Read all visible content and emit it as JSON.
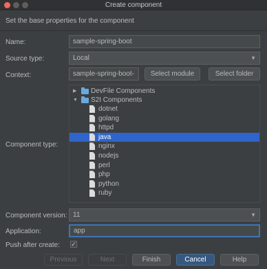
{
  "window": {
    "title": "Create component"
  },
  "header": {
    "text": "Set the base properties for the component"
  },
  "form": {
    "name_label": "Name:",
    "name_value": "sample-spring-boot",
    "source_label": "Source type:",
    "source_value": "Local",
    "context_label": "Context:",
    "context_value": "sample-spring-boot-",
    "select_module": "Select module",
    "select_folder": "Select folder",
    "component_type_label": "Component type:",
    "version_label": "Component version:",
    "version_value": "11",
    "application_label": "Application:",
    "application_value": "app",
    "push_label": "Push after create:",
    "push_checked": "✓"
  },
  "tree": {
    "devfile": "DevFile Components",
    "s2i": "S2I Components",
    "items": [
      "dotnet",
      "golang",
      "httpd",
      "java",
      "nginx",
      "nodejs",
      "perl",
      "php",
      "python",
      "ruby"
    ],
    "selected": "java"
  },
  "footer": {
    "previous": "Previous",
    "next": "Next",
    "finish": "Finish",
    "cancel": "Cancel",
    "help": "Help"
  }
}
